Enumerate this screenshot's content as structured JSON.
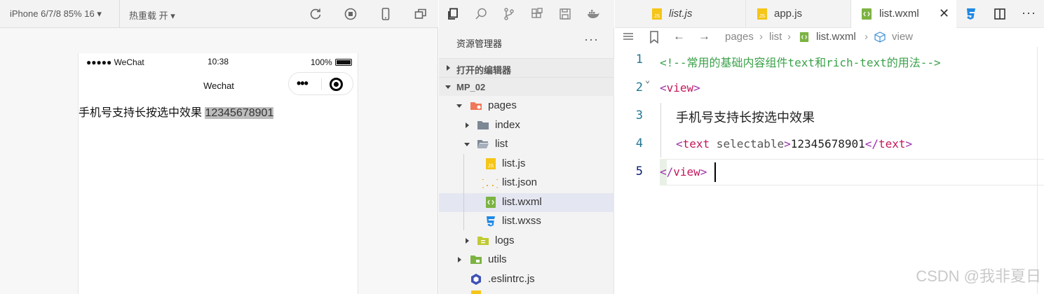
{
  "simulator": {
    "device_label": "iPhone 6/7/8 85% 16 ▾",
    "hot_reload_label": "热重载 开 ▾",
    "status_signal": "●●●●● WeChat",
    "status_time": "10:38",
    "status_battery": "100%",
    "nav_title": "Wechat",
    "content_text": "手机号支持长按选中效果 ",
    "selected_text": "12345678901"
  },
  "explorer": {
    "title": "资源管理器",
    "more": "···",
    "open_editors": "打开的编辑器",
    "project": "MP_02",
    "tree": [
      {
        "label": "pages"
      },
      {
        "label": "index"
      },
      {
        "label": "list"
      },
      {
        "label": "list.js"
      },
      {
        "label": "list.json"
      },
      {
        "label": "list.wxml"
      },
      {
        "label": "list.wxss"
      },
      {
        "label": "logs"
      },
      {
        "label": "utils"
      },
      {
        "label": ".eslintrc.js"
      }
    ]
  },
  "editor": {
    "tabs": [
      {
        "label": "list.js"
      },
      {
        "label": "app.js"
      },
      {
        "label": "list.wxml"
      }
    ],
    "breadcrumb": [
      "pages",
      "list",
      "list.wxml",
      "view"
    ],
    "line_numbers": [
      "1",
      "2",
      "3",
      "4",
      "5"
    ],
    "code": {
      "l1": "<!--常用的基础内容组件text和rich-text的用法-->",
      "l2_open": "<",
      "l2_tag": "view",
      "l2_close": ">",
      "l3": "手机号支持长按选中效果",
      "l4_open": "<",
      "l4_tag": "text",
      "l4_attr": " selectable",
      "l4_gt": ">",
      "l4_text": "12345678901",
      "l4_close_open": "</",
      "l4_close_tag": "text",
      "l4_close_gt": ">",
      "l5_open": "</",
      "l5_tag": "view",
      "l5_close": ">"
    }
  },
  "watermark": "CSDN @我非夏日",
  "colors": {
    "comment": "#3aa14a",
    "tag": "#c2185b",
    "bracket": "#9b2fae",
    "line_number": "#237893",
    "selection": "#bdbdbd",
    "active_tree_row": "#e4e6f1"
  }
}
